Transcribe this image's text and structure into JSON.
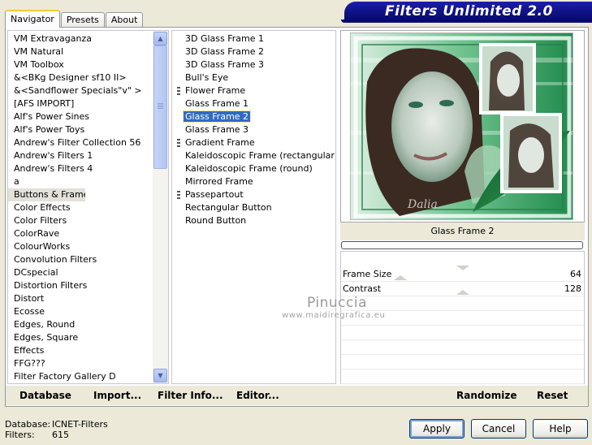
{
  "tabs": [
    {
      "label": "Navigator",
      "active": true
    },
    {
      "label": "Presets",
      "active": false
    },
    {
      "label": "About",
      "active": false
    }
  ],
  "banner": {
    "title": "Filters Unlimited 2.0"
  },
  "categories": [
    "VM Extravaganza",
    "VM Natural",
    "VM Toolbox",
    "&<BKg Designer sf10 II>",
    "&<Sandflower Specials\"v\" >",
    "[AFS IMPORT]",
    "Alf's Power Sines",
    "Alf's Power Toys",
    "Andrew's Filter Collection 56",
    "Andrew's Filters 1",
    "Andrew's Filters 4",
    "a",
    "Buttons & Frames",
    "Color Effects",
    "Color Filters",
    "ColorRave",
    "ColourWorks",
    "Convolution Filters",
    "DCspecial",
    "Distortion Filters",
    "Distort",
    "Ecosse",
    "Edges, Round",
    "Edges, Square",
    "Effects",
    "FFG???",
    "Filter Factory Gallery D"
  ],
  "selected_category": "Buttons & Frames",
  "filters": [
    {
      "label": "3D Glass Frame 1",
      "bullet": false
    },
    {
      "label": "3D Glass Frame 2",
      "bullet": false
    },
    {
      "label": "3D Glass Frame 3",
      "bullet": false
    },
    {
      "label": "Bull's Eye",
      "bullet": false
    },
    {
      "label": "Flower Frame",
      "bullet": true
    },
    {
      "label": "Glass Frame 1",
      "bullet": false
    },
    {
      "label": "Glass Frame 2",
      "bullet": false
    },
    {
      "label": "Glass Frame 3",
      "bullet": false
    },
    {
      "label": "Gradient Frame",
      "bullet": true
    },
    {
      "label": "Kaleidoscopic Frame (rectangular)",
      "bullet": false
    },
    {
      "label": "Kaleidoscopic Frame (round)",
      "bullet": false
    },
    {
      "label": "Mirrored Frame",
      "bullet": false
    },
    {
      "label": "Passepartout",
      "bullet": true
    },
    {
      "label": "Rectangular Button",
      "bullet": false
    },
    {
      "label": "Round Button",
      "bullet": false
    }
  ],
  "selected_filter": "Glass Frame 2",
  "preview": {
    "filter_name": "Glass Frame 2",
    "progress": 0
  },
  "params": [
    {
      "name": "Frame Size",
      "value": "64"
    },
    {
      "name": "Contrast",
      "value": "128"
    }
  ],
  "watermark": {
    "name": "Pinuccia",
    "url": "www.maidiregrafica.eu"
  },
  "bottom_buttons": {
    "database": "Database",
    "import": "Import...",
    "filter_info": "Filter Info...",
    "editor": "Editor...",
    "randomize": "Randomize",
    "reset": "Reset"
  },
  "status": {
    "database_label": "Database:",
    "database_value": "ICNET-Filters",
    "filters_label": "Filters:",
    "filters_value": "615"
  },
  "dialog_buttons": {
    "apply": "Apply",
    "cancel": "Cancel",
    "help": "Help"
  },
  "colors": {
    "banner": "#0b0d88",
    "selection": "#316ac5",
    "preview_green": "#3aa864"
  }
}
